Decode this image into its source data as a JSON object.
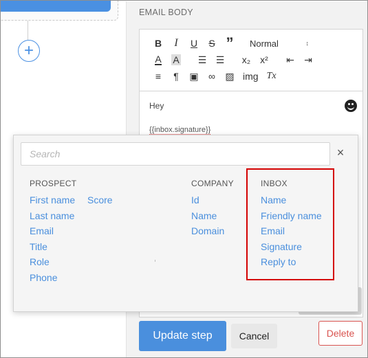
{
  "canvas": {
    "add_step_symbol": "+"
  },
  "editor": {
    "section_label": "EMAIL BODY",
    "toolbar": {
      "bold": "B",
      "italic": "I",
      "underline": "U",
      "strike": "S",
      "quote": "”",
      "format_select": "Normal",
      "format_arrow": "↕",
      "text_color": "A",
      "highlight": "A",
      "ordered_list": "☰",
      "bullet_list": "☰",
      "subscript": "x₂",
      "superscript": "x²",
      "outdent": "⇤",
      "indent": "⇥",
      "align": "≡",
      "direction": "¶",
      "save": "▣",
      "link": "∞",
      "image": "▨",
      "img_label": "img",
      "clear_format": "Tx"
    },
    "body": {
      "line1": "Hey",
      "line2": "{{inbox.signature}}"
    }
  },
  "popup": {
    "search_placeholder": "Search",
    "close_symbol": "×",
    "columns": {
      "prospect": {
        "heading": "PROSPECT",
        "items": [
          "First name",
          "Last name",
          "Email",
          "Title",
          "Role",
          "Phone"
        ],
        "extra": "Score"
      },
      "company": {
        "heading": "COMPANY",
        "items": [
          "Id",
          "Name",
          "Domain"
        ]
      },
      "inbox": {
        "heading": "INBOX",
        "items": [
          "Name",
          "Friendly name",
          "Email",
          "Signature",
          "Reply to"
        ]
      }
    }
  },
  "actions": {
    "update_label": "Update step",
    "cancel_label": "Cancel",
    "delete_label": "Delete"
  },
  "colors": {
    "primary": "#4a8fdd",
    "danger": "#d9534f",
    "highlight": "#d40000"
  }
}
